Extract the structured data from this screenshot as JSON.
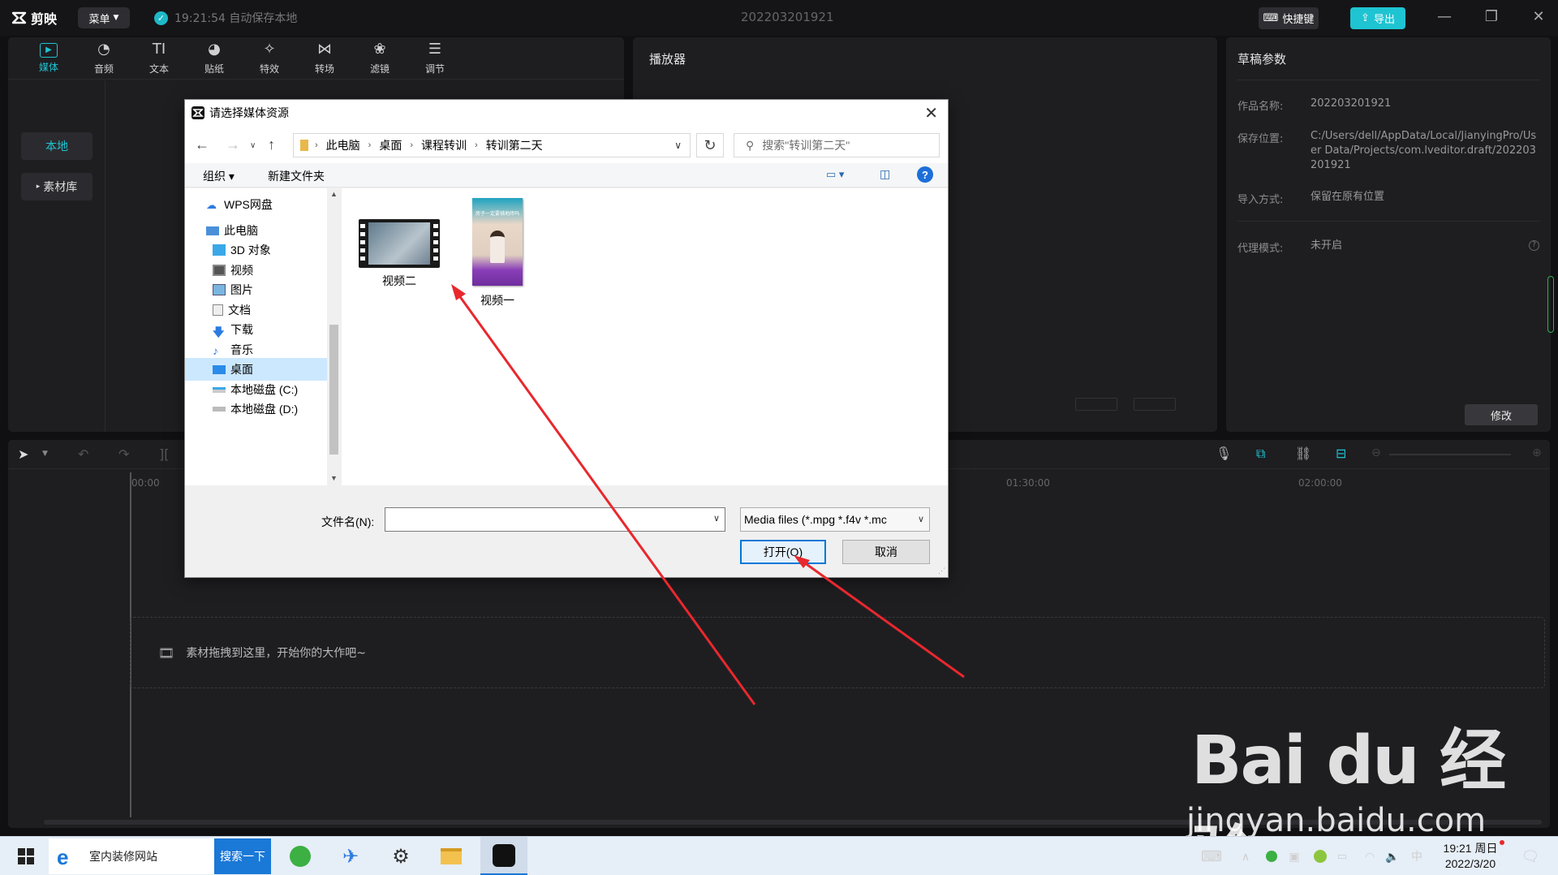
{
  "app": {
    "logo_text": "剪映",
    "menu_label": "菜单",
    "autosave_text": "19:21:54 自动保存本地",
    "project_title": "202203201921",
    "shortcut_label": "快捷键",
    "export_label": "导出",
    "accent_color": "#1ec4d2"
  },
  "media": {
    "tools": [
      {
        "label": "媒体",
        "icon": "media-icon",
        "active": true
      },
      {
        "label": "音频",
        "icon": "audio-icon"
      },
      {
        "label": "文本",
        "icon": "text-icon"
      },
      {
        "label": "贴纸",
        "icon": "sticker-icon"
      },
      {
        "label": "特效",
        "icon": "effects-icon"
      },
      {
        "label": "转场",
        "icon": "transition-icon"
      },
      {
        "label": "滤镜",
        "icon": "filter-icon"
      },
      {
        "label": "调节",
        "icon": "adjust-icon"
      }
    ],
    "side_local": "本地",
    "side_library": "素材库"
  },
  "player": {
    "title": "播放器"
  },
  "params": {
    "title": "草稿参数",
    "name_label": "作品名称:",
    "name_value": "202203201921",
    "path_label": "保存位置:",
    "path_value": "C:/Users/dell/AppData/Local/JianyingPro/User Data/Projects/com.lveditor.draft/202203201921",
    "import_label": "导入方式:",
    "import_value": "保留在原有位置",
    "proxy_label": "代理模式:",
    "proxy_value": "未开启",
    "modify_label": "修改"
  },
  "timeline": {
    "ticks": [
      "00:00",
      "01:30:00",
      "02:00:00"
    ],
    "drop_hint": "素材拖拽到这里，开始你的大作吧~"
  },
  "dialog": {
    "title": "请选择媒体资源",
    "breadcrumb": [
      "此电脑",
      "桌面",
      "课程转训",
      "转训第二天"
    ],
    "search_placeholder": "搜索\"转训第二天\"",
    "organize_label": "组织 ▾",
    "new_folder_label": "新建文件夹",
    "tree": [
      "WPS网盘",
      "此电脑",
      "3D 对象",
      "视频",
      "图片",
      "文档",
      "下载",
      "音乐",
      "桌面",
      "本地磁盘 (C:)",
      "本地磁盘 (D:)"
    ],
    "selected_tree_item": "桌面",
    "files": [
      {
        "name": "视频二",
        "type": "video"
      },
      {
        "name": "视频一",
        "type": "video",
        "thumb_text": "房子一定要铺地砖吗"
      }
    ],
    "filename_label": "文件名(N):",
    "filename_value": "",
    "filter_value": "Media files (*.mpg *.f4v *.mc",
    "open_label": "打开(O)",
    "cancel_label": "取消"
  },
  "taskbar": {
    "search_text": "室内装修网站",
    "search_button": "搜索一下",
    "ime": "中",
    "time": "19:21 周日",
    "date": "2022/3/20"
  },
  "watermark": {
    "logo": "Bai du 经验",
    "url": "jingyan.baidu.com"
  }
}
